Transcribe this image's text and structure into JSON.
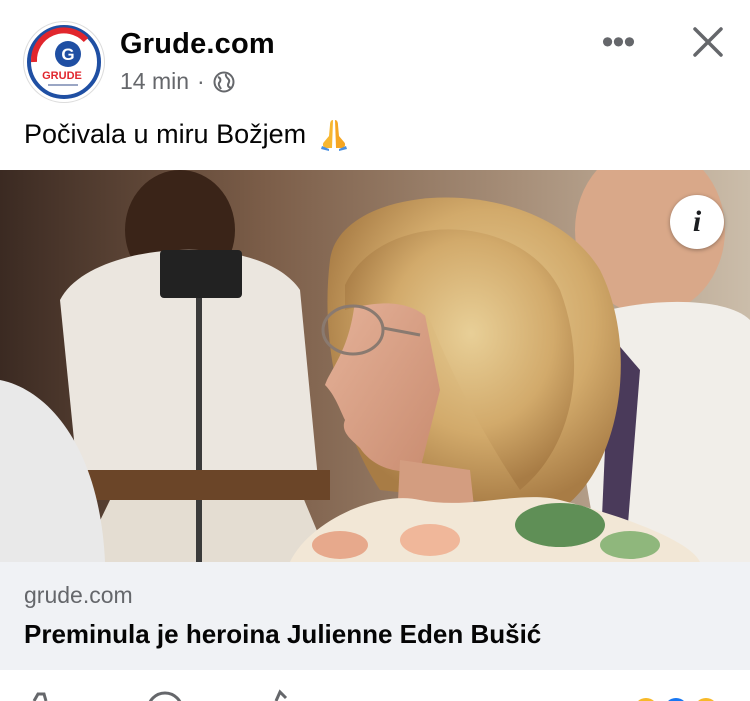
{
  "post": {
    "page_name": "Grude.com",
    "time": "14 min",
    "separator": "·",
    "audience_icon": "globe-icon",
    "text": "Počivala u miru Božjem",
    "emoji_icon": "folded-hands-icon"
  },
  "avatar": {
    "logo_letter": "G",
    "logo_text": "GRUDE",
    "brand_colors": {
      "red": "#e1262d",
      "blue": "#1f4fa3"
    }
  },
  "header_actions": {
    "more_label": "•••",
    "close_icon": "close-icon"
  },
  "photo": {
    "info_label": "i"
  },
  "link_preview": {
    "domain": "grude.com",
    "title": "Preminula je heroina Julienne Eden Bušić"
  },
  "colors": {
    "secondary_text": "#65676b",
    "link_box_bg": "#f0f2f5",
    "primary_text": "#050505"
  }
}
